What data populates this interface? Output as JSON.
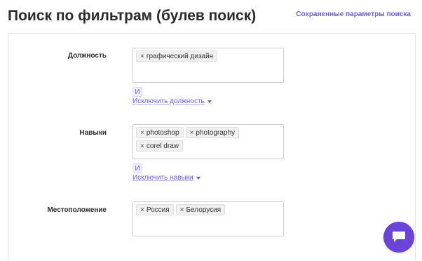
{
  "header": {
    "title": "Поиск по фильтрам (булев поиск)",
    "saved_params_link": "Сохраненные параметры поиска"
  },
  "filters": {
    "position": {
      "label": "Должность",
      "tags": [
        "графический дизайн"
      ],
      "and_label": "И",
      "exclude_label": "Исключить должность"
    },
    "skills": {
      "label": "Навыки",
      "tags": [
        "photoshop",
        "photography",
        "corel draw"
      ],
      "and_label": "И",
      "exclude_label": "Исключить навыки"
    },
    "location": {
      "label": "Местоположение",
      "tags": [
        "Россия",
        "Белорусия"
      ]
    }
  },
  "tag_remove_glyph": "×",
  "colors": {
    "accent": "#6b5fd3",
    "chat_button": "#6a44d6"
  },
  "icons": {
    "remove_tag": "close-icon",
    "dropdown": "caret-down-icon",
    "chat": "chat-bubble-icon"
  }
}
